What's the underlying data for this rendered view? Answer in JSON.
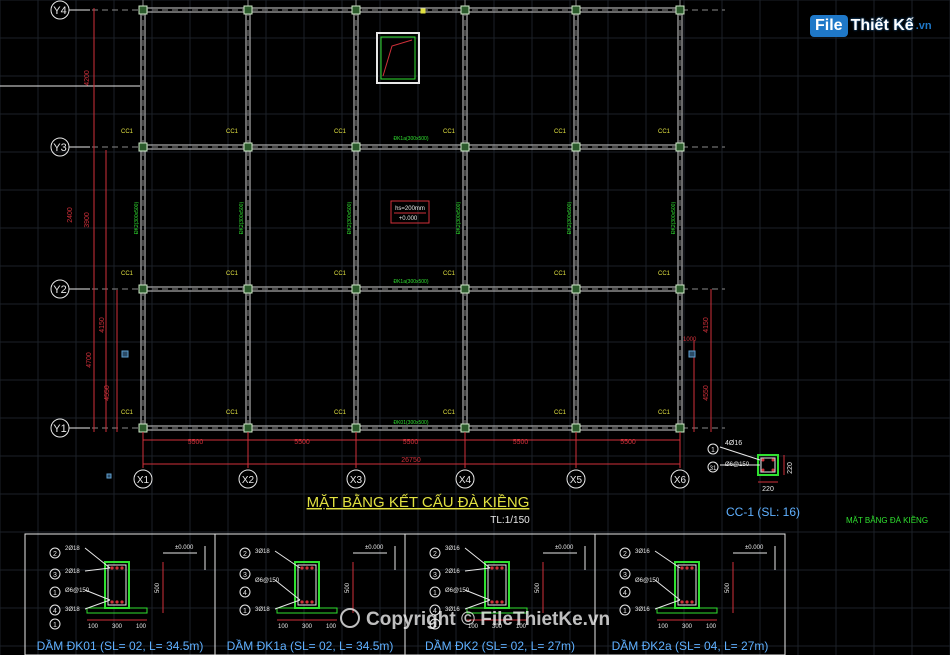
{
  "brand": {
    "logo_file": "File",
    "logo_rest": "Thiết Kế",
    "logo_vn": ".vn"
  },
  "watermark": "Copyright © FileThietKe.vn",
  "plan": {
    "y_axes": [
      "Y4",
      "Y3",
      "Y2",
      "Y1"
    ],
    "x_axes": [
      "X1",
      "X2",
      "X3",
      "X4",
      "X5",
      "X6"
    ],
    "x_spans": [
      "5500",
      "5500",
      "5500",
      "5500",
      "5500"
    ],
    "total_x": "26750",
    "left_dims": [
      "4200",
      "3900",
      "2400",
      "4150",
      "4700",
      "4550"
    ],
    "right_dims": [
      "4150",
      "4550",
      "1000"
    ],
    "column_label": "CC1",
    "beam_h_labels": [
      "ĐK1a(300x500)",
      "ĐK1a(300x500)",
      "ĐK01(300x500)"
    ],
    "beam_v_label": "ĐK2(300x500)",
    "slab_note": "hs=200mm",
    "slab_level": "+0.000",
    "title": "MẶT BẰNG  KẾT CẤU ĐÀ KIỀNG",
    "scale": "TL:1/150",
    "side_title": "MẶT BẰNG ĐÀ KIỀNG"
  },
  "column_detail": {
    "label": "CC-1 (SL: 16)",
    "bar_top": "4Ø16",
    "stirrup": "Ø6@150",
    "dim_w": "220",
    "dim_h": "220",
    "markers": [
      "1",
      "31"
    ]
  },
  "beams": [
    {
      "caption": "DẦM ĐK01 (SL= 02, L= 34.5m)",
      "bars": [
        "2Ø18",
        "2Ø18",
        "Ø6@150",
        "3Ø18"
      ],
      "markers": [
        "2",
        "3",
        "1",
        "4",
        "1"
      ],
      "level": "±0.000",
      "dims": [
        "100",
        "300",
        "100"
      ],
      "height": "500"
    },
    {
      "caption": "DẦM ĐK1a (SL= 02, L= 34.5m)",
      "bars": [
        "3Ø18",
        "Ø6@150",
        "3Ø18"
      ],
      "markers": [
        "2",
        "3",
        "4",
        "1"
      ],
      "level": "±0.000",
      "dims": [
        "100",
        "300",
        "100"
      ],
      "height": "500"
    },
    {
      "caption": "DẦM ĐK2 (SL= 02, L= 27m)",
      "bars": [
        "3Ø16",
        "2Ø16",
        "Ø6@150",
        "3Ø16"
      ],
      "markers": [
        "2",
        "3",
        "1",
        "4",
        "1"
      ],
      "level": "±0.000",
      "dims": [
        "100",
        "300",
        "100"
      ],
      "height": "500"
    },
    {
      "caption": "DẦM ĐK2a (SL= 04, L= 27m)",
      "bars": [
        "3Ø16",
        "Ø6@150",
        "3Ø16"
      ],
      "markers": [
        "2",
        "3",
        "4",
        "1"
      ],
      "level": "±0.000",
      "dims": [
        "100",
        "300",
        "100"
      ],
      "height": "500"
    }
  ]
}
